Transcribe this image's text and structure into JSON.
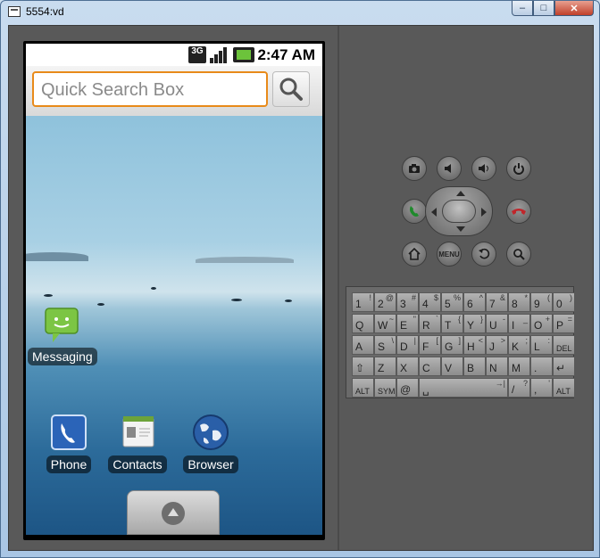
{
  "window": {
    "title": "5554:vd",
    "controls": [
      "–",
      "□",
      "✕"
    ]
  },
  "statusbar": {
    "time": "2:47 AM",
    "network": "3G"
  },
  "search": {
    "placeholder": "Quick Search Box"
  },
  "home_apps": [
    {
      "label": "Messaging",
      "icon": "messaging-icon"
    },
    {
      "label": "Phone",
      "icon": "phone-icon"
    },
    {
      "label": "Contacts",
      "icon": "contacts-icon"
    },
    {
      "label": "Browser",
      "icon": "browser-icon"
    }
  ],
  "hw_buttons": {
    "camera": "camera-icon",
    "volume_down": "volume-down-icon",
    "volume_up": "volume-up-icon",
    "power": "power-icon",
    "call": "call-icon",
    "end_call": "end-call-icon",
    "home": "home-icon",
    "menu": "MENU",
    "back": "back-icon",
    "search": "search-icon"
  },
  "keyboard": {
    "rows": [
      [
        [
          "1",
          "!"
        ],
        [
          "2",
          "@"
        ],
        [
          "3",
          "#"
        ],
        [
          "4",
          "$"
        ],
        [
          "5",
          "%"
        ],
        [
          "6",
          "^"
        ],
        [
          "7",
          "&"
        ],
        [
          "8",
          "*"
        ],
        [
          "9",
          "("
        ],
        [
          "0",
          ")"
        ]
      ],
      [
        [
          "Q",
          ""
        ],
        [
          "W",
          "~"
        ],
        [
          "E",
          "\""
        ],
        [
          "R",
          "`"
        ],
        [
          "T",
          "{"
        ],
        [
          "Y",
          "}"
        ],
        [
          "U",
          "-"
        ],
        [
          "I",
          "_"
        ],
        [
          "O",
          "+"
        ],
        [
          "P",
          "="
        ]
      ],
      [
        [
          "A",
          ""
        ],
        [
          "S",
          "\\"
        ],
        [
          "D",
          "|"
        ],
        [
          "F",
          "["
        ],
        [
          "G",
          "]"
        ],
        [
          "H",
          "<"
        ],
        [
          "J",
          ">"
        ],
        [
          "K",
          ";"
        ],
        [
          "L",
          ":"
        ],
        [
          "DEL",
          ""
        ]
      ],
      [
        [
          "⇧",
          ""
        ],
        [
          "Z",
          ""
        ],
        [
          "X",
          ""
        ],
        [
          "C",
          ""
        ],
        [
          "V",
          ""
        ],
        [
          "B",
          ""
        ],
        [
          "N",
          ""
        ],
        [
          "M",
          ""
        ],
        [
          ".",
          ""
        ],
        [
          "↵",
          ""
        ]
      ],
      [
        [
          "ALT",
          ""
        ],
        [
          "SYM",
          ""
        ],
        [
          "@",
          ""
        ],
        [
          "␣",
          "→|"
        ],
        [
          "/",
          "?"
        ],
        [
          ",",
          "'"
        ],
        [
          "ALT",
          ""
        ]
      ]
    ]
  }
}
